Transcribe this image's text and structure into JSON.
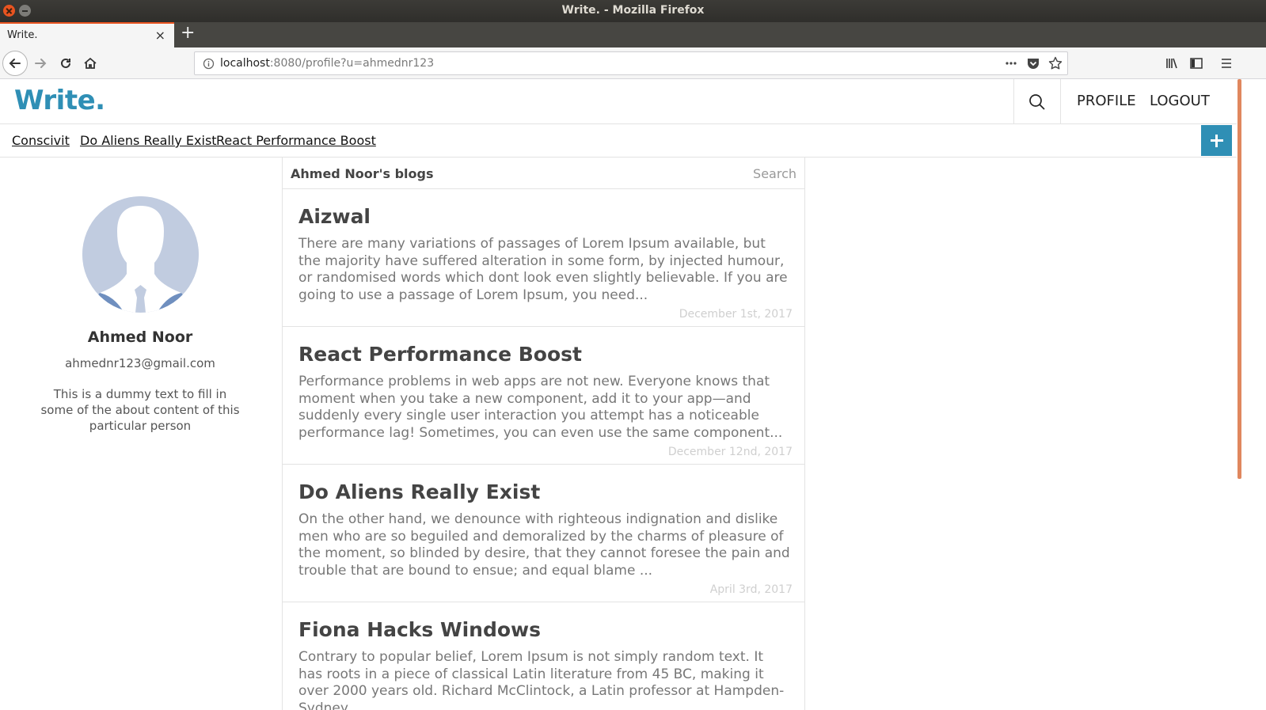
{
  "window": {
    "title": "Write. - Mozilla Firefox"
  },
  "tab": {
    "label": "Write.",
    "close": "×"
  },
  "newtab": "+",
  "url": {
    "host": "localhost",
    "rest": ":8080/profile?u=ahmednr123"
  },
  "site": {
    "logo": "Write.",
    "nav_profile": "PROFILE",
    "nav_logout": "LOGOUT"
  },
  "subnav": [
    "Conscivit",
    "Do Aliens Really Exist",
    "React Performance Boost"
  ],
  "profile": {
    "name": "Ahmed Noor",
    "email": "ahmednr123@gmail.com",
    "about": "This is a dummy text to fill in some of the about content of this particular person"
  },
  "blogs": {
    "title": "Ahmed Noor's blogs",
    "search": "Search",
    "posts": [
      {
        "title": "Aizwal",
        "excerpt": "There are many variations of passages of Lorem Ipsum available, but the majority have suffered alteration in some form, by injected humour, or randomised words which dont look even slightly believable. If you are going to use a passage of Lorem Ipsum, you need...",
        "date": "December 1st, 2017"
      },
      {
        "title": "React Performance Boost",
        "excerpt": "Performance problems in web apps are not new. Everyone knows that moment when you take a new component, add it to your app—and suddenly every single user interaction you attempt has a noticeable performance lag! Sometimes, you can even use the same component...",
        "date": "December 12nd, 2017"
      },
      {
        "title": "Do Aliens Really Exist",
        "excerpt": "On the other hand, we denounce with righteous indignation and dislike men who are so beguiled and demoralized by the charms of pleasure of the moment, so blinded by desire, that they cannot foresee the pain and trouble that are bound to ensue; and equal blame ...",
        "date": "April 3rd, 2017"
      },
      {
        "title": "Fiona Hacks Windows",
        "excerpt": "Contrary to popular belief, Lorem Ipsum is not simply random text. It has roots in a piece of classical Latin literature from 45 BC, making it over 2000 years old. Richard McClintock, a Latin professor at Hampden-Sydney",
        "date": ""
      }
    ]
  },
  "colors": {
    "brand": "#2f8fb5",
    "ubuntu_orange": "#e95420"
  },
  "icons": [
    "close-window-icon",
    "minimize-window-icon",
    "back-icon",
    "forward-icon",
    "reload-icon",
    "home-icon",
    "info-icon",
    "more-icon",
    "pocket-icon",
    "bookmark-star-icon",
    "library-icon",
    "sidebar-icon",
    "menu-icon",
    "search-icon",
    "plus-icon"
  ]
}
